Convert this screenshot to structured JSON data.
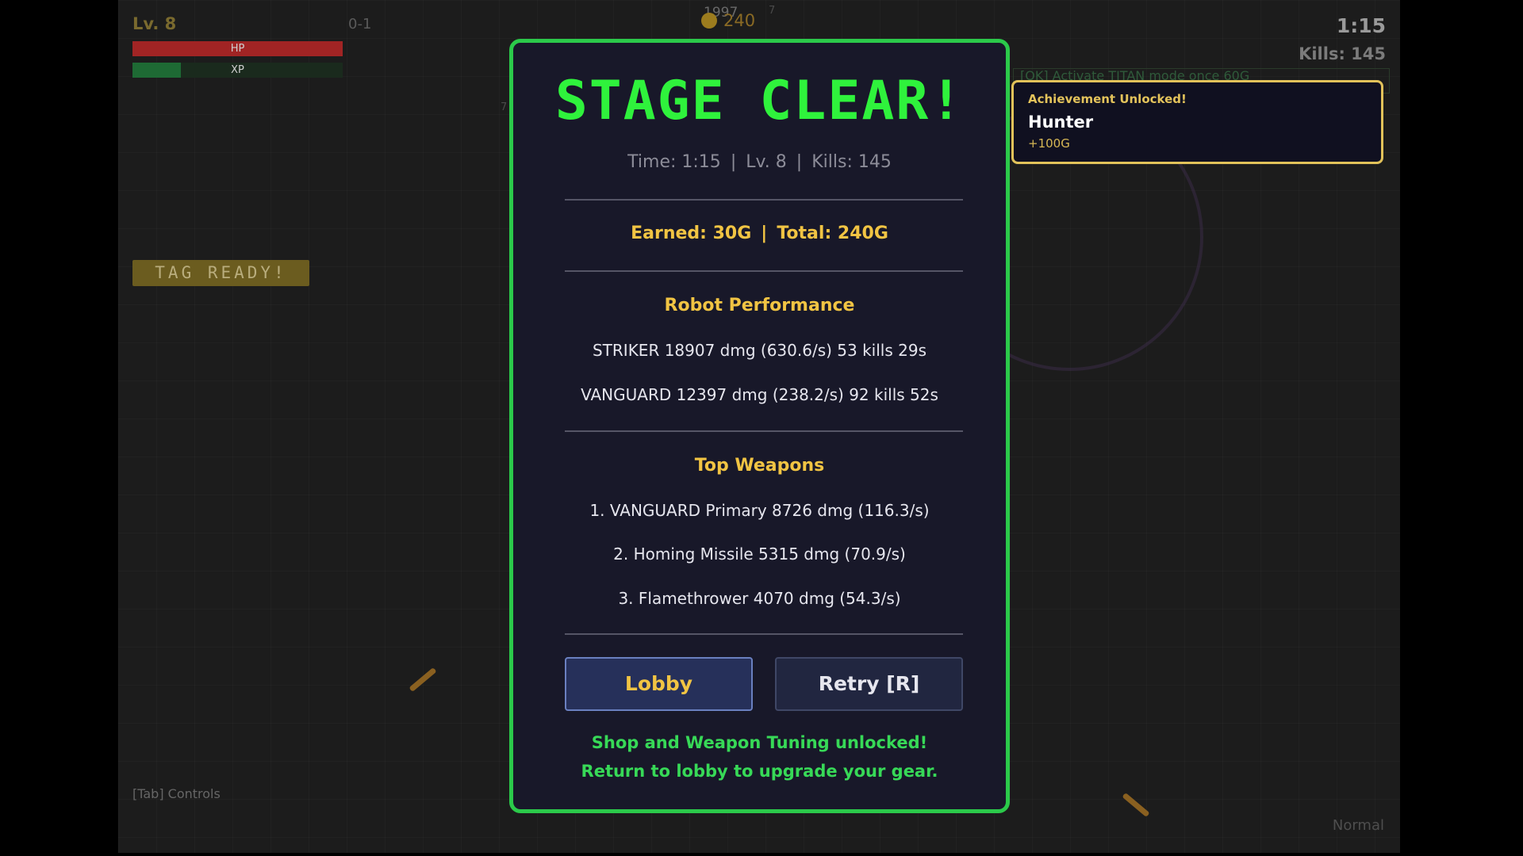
{
  "hud": {
    "level": "Lv. 8",
    "stage": "0-1",
    "hp_label": "HP",
    "hp_fraction": 1.0,
    "xp_label": "XP",
    "xp_fraction": 0.23,
    "tag_ready": "TAG READY!",
    "controls_hint": "[Tab] Controls",
    "time": "1:15",
    "kills": "Kills: 145",
    "difficulty": "Normal",
    "gold": "240",
    "damage_numbers": [
      "1997",
      "7",
      "7",
      "1997"
    ],
    "quest_text": "[OK] Activate TITAN mode once     60G"
  },
  "achievement": {
    "header": "Achievement Unlocked!",
    "title": "Hunter",
    "reward": "+100G"
  },
  "result": {
    "title": "STAGE CLEAR!",
    "time": "Time: 1:15",
    "level": "Lv. 8",
    "kills": "Kills: 145",
    "separator": "|",
    "earned": "Earned: 30G",
    "total": "Total: 240G",
    "robot_performance_title": "Robot Performance",
    "robots": [
      "STRIKER  18907 dmg (630.6/s)  53 kills  29s",
      "VANGUARD  12397 dmg (238.2/s)  92 kills  52s"
    ],
    "top_weapons_title": "Top Weapons",
    "weapons": [
      "1. VANGUARD Primary  8726 dmg (116.3/s)",
      "2. Homing Missile  5315 dmg (70.9/s)",
      "3. Flamethrower  4070 dmg (54.3/s)"
    ],
    "lobby_button": "Lobby",
    "retry_button": "Retry  [R]",
    "unlock_line1": "Shop and Weapon Tuning unlocked!",
    "unlock_line2": "Return to lobby to upgrade your gear."
  },
  "colors": {
    "accent_green": "#2ff23c",
    "gold": "#f1c443",
    "modal_bg": "#181829",
    "border_green": "#2bc94a"
  }
}
